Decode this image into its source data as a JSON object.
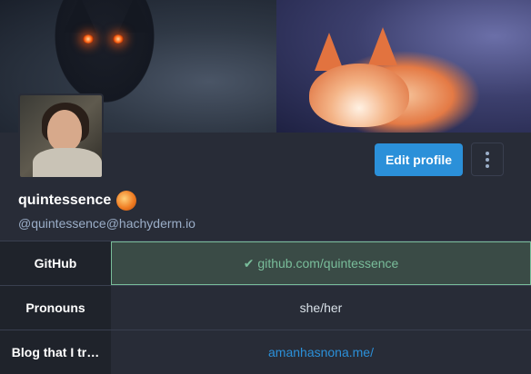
{
  "profile": {
    "display_name": "quintessence",
    "handle": "@quintessence@hachyderm.io",
    "edit_label": "Edit profile"
  },
  "fields": [
    {
      "name": "GitHub",
      "value": "github.com/quintessence",
      "verified": true
    },
    {
      "name": "Pronouns",
      "value": "she/her",
      "verified": false
    },
    {
      "name": "Blog that I tr…",
      "value": "amanhasnona.me/",
      "verified": false,
      "link": true
    }
  ],
  "colors": {
    "accent": "#2b90d9",
    "verified": "#79bd9a",
    "background": "#282c37"
  },
  "icons": {
    "more": "more-vertical-icon",
    "verified": "check-icon"
  }
}
